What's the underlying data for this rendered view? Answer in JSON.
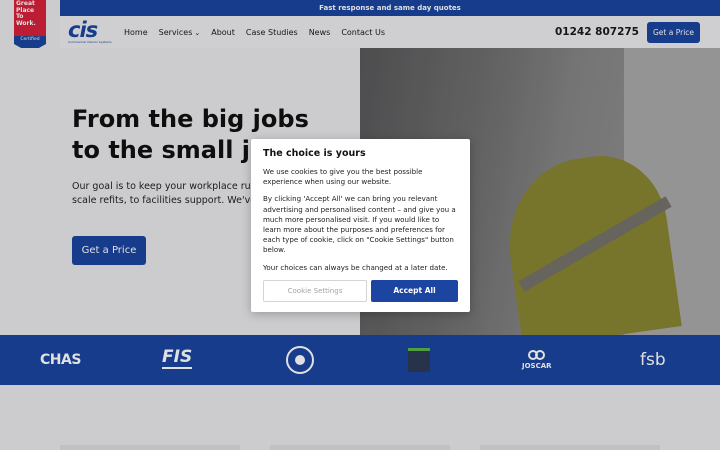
{
  "topbar": {
    "text": "Fast response and same day quotes"
  },
  "badge": {
    "lines": [
      "Great",
      "Place",
      "To",
      "Work."
    ],
    "certified": "Certified"
  },
  "logo": {
    "mark": "cis",
    "tagline": "Commercial Interior Systems"
  },
  "nav": {
    "items": [
      {
        "label": "Home"
      },
      {
        "label": "Services",
        "has_dropdown": true
      },
      {
        "label": "About"
      },
      {
        "label": "Case Studies"
      },
      {
        "label": "News"
      },
      {
        "label": "Contact Us"
      }
    ],
    "phone": "01242 807275",
    "cta": "Get a Price"
  },
  "hero": {
    "headline_line1": "From the big jobs",
    "headline_line2": "to the small jobs",
    "copy": "Our goal is to keep your workplace running perfectly. From full-scale refits, to facilities support. We've got you covered.",
    "cta": "Get a Price"
  },
  "accreditations": {
    "chas": "CHAS",
    "fis": "FIS",
    "joscar": "JOSCAR",
    "fsb": "fsb"
  },
  "cookie_modal": {
    "title": "The choice is yours",
    "p1": "We use cookies to give you the best possible experience when using our website.",
    "p2": "By clicking 'Accept All' we can bring you relevant advertising and personalised content – and give you a much more personalised visit. If you would like to learn more about the purposes and preferences for each type of cookie, click on \"Cookie Settings\" button below.",
    "p3": "Your choices can always be changed at a later date.",
    "settings_label": "Cookie Settings",
    "accept_label": "Accept All"
  },
  "colors": {
    "brand_blue": "#1b45a0",
    "badge_red": "#d8213a"
  }
}
